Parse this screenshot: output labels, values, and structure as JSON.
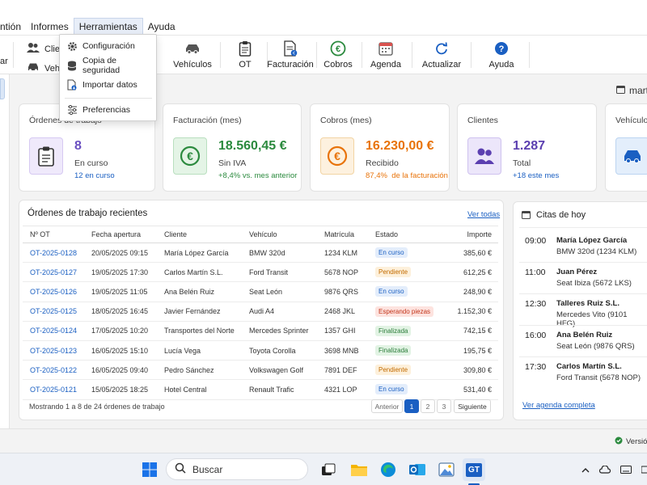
{
  "menubar": {
    "items": [
      "ntión",
      "Informes",
      "Herramientas",
      "Ayuda"
    ],
    "active": "Herramientas"
  },
  "dropdown": {
    "items": [
      "Configuración",
      "Copia de seguridad",
      "Importar datos",
      "Preferencias"
    ]
  },
  "toolbar": {
    "left_partial": "ar",
    "clientes_partial": "Clie",
    "vehiculos_partial": "Vehi",
    "buttons": [
      "Vehículos",
      "OT",
      "Facturación",
      "Cobros",
      "Agenda",
      "Actualizar",
      "Ayuda"
    ]
  },
  "header": {
    "date_partial": "mart"
  },
  "kpis": [
    {
      "title": "Órdenes de trabajo",
      "value": "8",
      "sub": "En curso",
      "note": "12 en curso",
      "color": "#6a4fc1"
    },
    {
      "title": "Facturación (mes)",
      "value": "18.560,45 €",
      "sub": "Sin IVA",
      "note": "+8,4% vs. mes anterior",
      "color": "#2b8a3e"
    },
    {
      "title": "Cobros (mes)",
      "value": "16.230,00 €",
      "sub": "Recibido",
      "note_pct": "87,4%",
      "note_rest": "de la facturación",
      "color": "#e8730a"
    },
    {
      "title": "Clientes",
      "value": "1.287",
      "sub": "Total",
      "note": "+18 este mes",
      "color": "#5b3fb0"
    },
    {
      "title": "Vehículos"
    }
  ],
  "orders": {
    "title": "Órdenes de trabajo recientes",
    "view_all": "Ver todas",
    "headers": [
      "Nº OT",
      "Fecha apertura",
      "Cliente",
      "Vehículo",
      "Matrícula",
      "Estado",
      "Importe"
    ],
    "rows": [
      {
        "ot": "OT-2025-0128",
        "date": "20/05/2025 09:15",
        "client": "María López García",
        "vehicle": "BMW 320d",
        "plate": "1234 KLM",
        "status": "En curso",
        "type": "blue",
        "amount": "385,60 €"
      },
      {
        "ot": "OT-2025-0127",
        "date": "19/05/2025 17:30",
        "client": "Carlos Martín S.L.",
        "vehicle": "Ford Transit",
        "plate": "5678 NOP",
        "status": "Pendiente",
        "type": "orange",
        "amount": "612,25 €"
      },
      {
        "ot": "OT-2025-0126",
        "date": "19/05/2025 11:05",
        "client": "Ana Belén Ruiz",
        "vehicle": "Seat León",
        "plate": "9876 QRS",
        "status": "En curso",
        "type": "blue",
        "amount": "248,90 €"
      },
      {
        "ot": "OT-2025-0125",
        "date": "18/05/2025 16:45",
        "client": "Javier Fernández",
        "vehicle": "Audi A4",
        "plate": "2468 JKL",
        "status": "Esperando piezas",
        "type": "red",
        "amount": "1.152,30 €"
      },
      {
        "ot": "OT-2025-0124",
        "date": "17/05/2025 10:20",
        "client": "Transportes del Norte",
        "vehicle": "Mercedes Sprinter",
        "plate": "1357 GHI",
        "status": "Finalizada",
        "type": "green",
        "amount": "742,15 €"
      },
      {
        "ot": "OT-2025-0123",
        "date": "16/05/2025 15:10",
        "client": "Lucía Vega",
        "vehicle": "Toyota Corolla",
        "plate": "3698 MNB",
        "status": "Finalizada",
        "type": "green",
        "amount": "195,75 €"
      },
      {
        "ot": "OT-2025-0122",
        "date": "16/05/2025 09:40",
        "client": "Pedro Sánchez",
        "vehicle": "Volkswagen Golf",
        "plate": "7891 DEF",
        "status": "Pendiente",
        "type": "orange",
        "amount": "309,80 €"
      },
      {
        "ot": "OT-2025-0121",
        "date": "15/05/2025 18:25",
        "client": "Hotel Central",
        "vehicle": "Renault Trafic",
        "plate": "4321 LOP",
        "status": "En curso",
        "type": "blue",
        "amount": "531,40 €"
      }
    ],
    "footer": "Mostrando 1 a 8 de 24 órdenes de trabajo",
    "pager": {
      "prev": "Anterior",
      "pages": [
        "1",
        "2",
        "3"
      ],
      "next": "Siguiente",
      "current": "1"
    }
  },
  "appointments": {
    "title": "Citas de hoy",
    "items": [
      {
        "time": "09:00",
        "name": "María López García",
        "vehicle": "BMW 320d (1234 KLM)"
      },
      {
        "time": "11:00",
        "name": "Juan Pérez",
        "vehicle": "Seat Ibiza (5672 LKS)"
      },
      {
        "time": "12:30",
        "name": "Talleres Ruiz S.L.",
        "vehicle": "Mercedes Vito (9101 HFG)"
      },
      {
        "time": "16:00",
        "name": "Ana Belén Ruiz",
        "vehicle": "Seat León (9876 QRS)"
      },
      {
        "time": "17:30",
        "name": "Carlos Martín S.L.",
        "vehicle": "Ford Transit (5678 NOP)"
      }
    ],
    "link": "Ver agenda completa"
  },
  "statusbar": {
    "version_partial": "Versión"
  },
  "taskbar": {
    "search": "Buscar",
    "app_badge": "GT"
  }
}
